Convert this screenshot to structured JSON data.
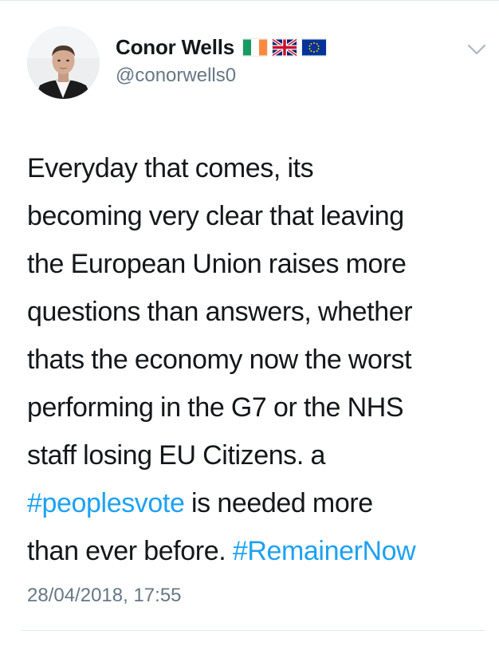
{
  "tweet": {
    "author": {
      "display_name": "Conor Wells",
      "handle": "@conorwells0",
      "flags": [
        "ireland-flag-icon",
        "uk-flag-icon",
        "eu-flag-icon"
      ]
    },
    "text_lines": [
      {
        "text": "Everyday that comes, its"
      },
      {
        "text": "becoming very clear that leaving"
      },
      {
        "text": "the European Union raises more"
      },
      {
        "text": "questions than answers, whether"
      },
      {
        "text": "thats the economy now the worst"
      },
      {
        "text": "performing in the G7 or the NHS"
      },
      {
        "text": "staff losing EU Citizens. a"
      },
      {
        "hashtag": "#peoplesvote",
        "after": " is needed more"
      },
      {
        "before": "than ever before. ",
        "hashtag": "#RemainerNow"
      }
    ],
    "timestamp": "28/04/2018, 17:55",
    "menu_icon": "chevron-down-icon"
  },
  "colors": {
    "text": "#14171a",
    "secondary": "#657786",
    "link": "#1da1f2",
    "divider": "#e1e8ed"
  }
}
